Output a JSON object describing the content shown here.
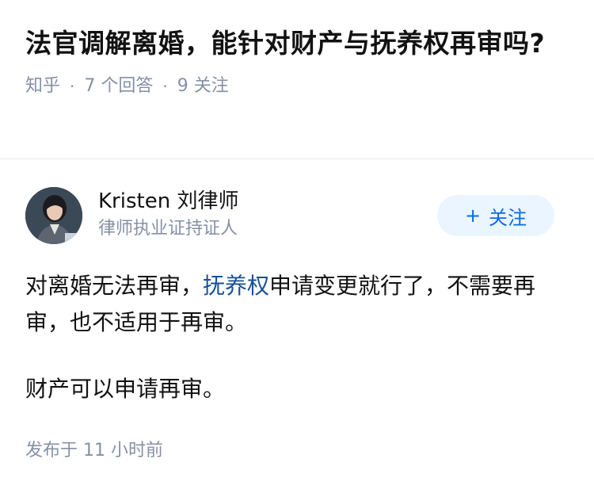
{
  "question": {
    "title": "法官调解离婚，能针对财产与抚养权再审吗?",
    "source": "知乎",
    "answer_count": "7 个回答",
    "follow_count": "9 关注"
  },
  "author": {
    "name": "Kristen 刘律师",
    "badge": "律师执业证持证人",
    "follow_label": "关注",
    "follow_icon": "plus-icon"
  },
  "answer": {
    "para1_before": "对离婚无法再审，",
    "para1_link": "抚养权",
    "para1_after": "申请变更就行了，不需要再审，也不适用于再审。",
    "para2": "财产可以申请再审。",
    "time": "发布于 11 小时前"
  },
  "colors": {
    "meta_gray": "#8590a6",
    "link_blue": "#175199",
    "follow_blue": "#056de8",
    "follow_bg": "#ebf5ff"
  }
}
